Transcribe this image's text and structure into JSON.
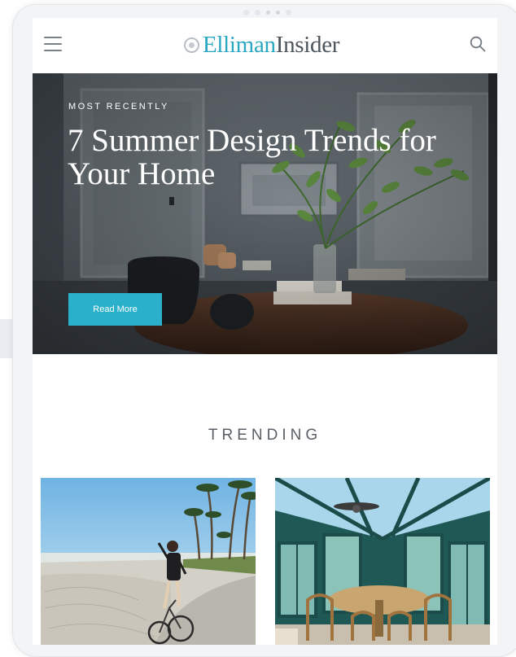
{
  "header": {
    "logo_part1": "Elliman",
    "logo_part2": "Insider",
    "menu_icon": "hamburger-icon",
    "search_icon": "search-icon"
  },
  "hero": {
    "kicker": "MOST RECENTLY",
    "title": "7 Summer Design Trends for Your Home",
    "cta_label": "Read More"
  },
  "trending": {
    "heading": "TRENDING",
    "cards": [
      {
        "image": "beach-cyclist-photo"
      },
      {
        "image": "sunroom-dining-photo"
      }
    ]
  },
  "colors": {
    "brand_blue": "#2aa8c1",
    "button": "#2ab0cb",
    "logo_gray": "#4d555c",
    "heading_gray": "#5a6066"
  }
}
